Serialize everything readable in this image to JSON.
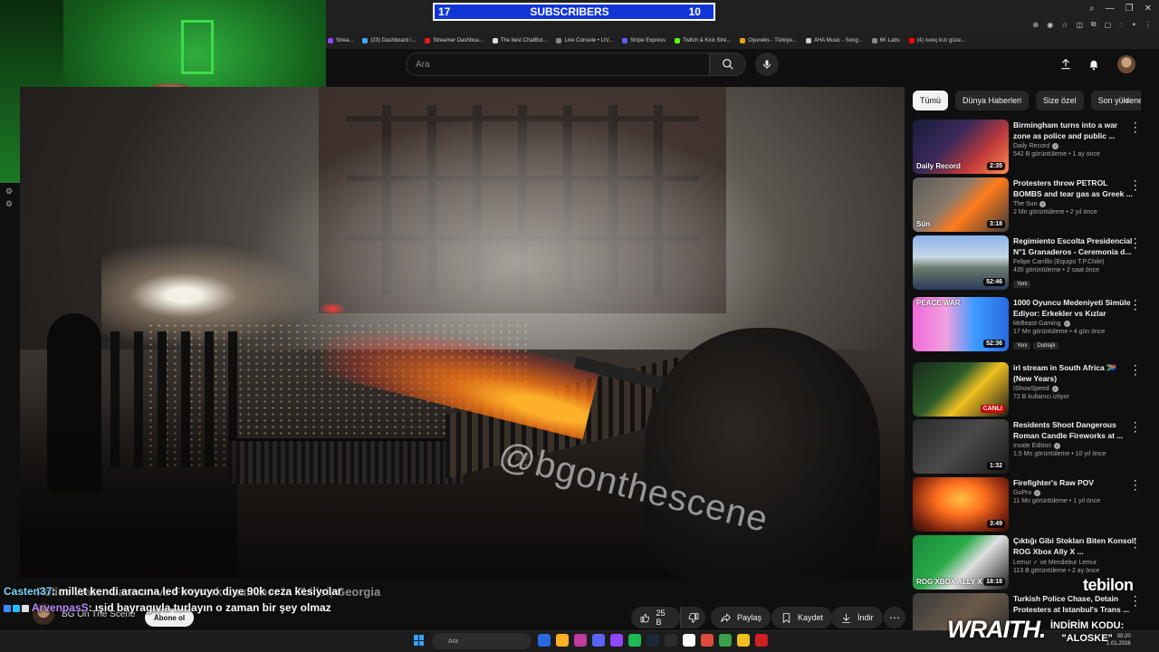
{
  "overlay": {
    "subscriber_bar": {
      "current": "17",
      "label": "SUBSCRIBERS",
      "goal": "10"
    },
    "tebilon": "tebilon",
    "wraith": "WRAITH.",
    "promo_label": "İNDİRİM KODU:",
    "promo_code": "\"ALOSKE\""
  },
  "bookmarks": [
    {
      "label": "Strea...",
      "color": "#9146ff"
    },
    {
      "label": "(23) Dashboard /...",
      "color": "#3ea6ff"
    },
    {
      "label": "Streamer Dashboa...",
      "color": "#e91916"
    },
    {
      "label": "The best ChatBot...",
      "color": "#dddddd"
    },
    {
      "label": "Live Console • LIV...",
      "color": "#888888"
    },
    {
      "label": "Stripe Express",
      "color": "#635bff"
    },
    {
      "label": "Twitch & Kick Stre...",
      "color": "#53fc18"
    },
    {
      "label": "Oyuneks - Türkiye...",
      "color": "#e8a317"
    },
    {
      "label": "AHA Music - Song...",
      "color": "#cccccc"
    },
    {
      "label": "6K Labs",
      "color": "#888888"
    },
    {
      "label": "(4) isveç kızı güze...",
      "color": "#ff0000"
    }
  ],
  "search": {
    "placeholder": "Ara"
  },
  "video": {
    "watermark": "@bgonthescene",
    "title": "Police Water Cannon vs Firework Launcher in Tbilisi, Georgia",
    "channel": "BG On The Scene",
    "subscribe_label": "Abone ol",
    "likes": "25 B",
    "share_label": "Paylaş",
    "save_label": "Kaydet",
    "download_label": "İndir"
  },
  "chat": [
    {
      "user": "Casten37",
      "message": ": millet kendi aracına led koyuyo diye 90k ceza kesiyolar"
    },
    {
      "user": "ArvenpasS",
      "message": ": ışid bayragıyla turlayın o zaman bir şey olmaz"
    }
  ],
  "chips": [
    "Tümü",
    "Dünya Haberleri",
    "Size özel",
    "Son yüklenenler"
  ],
  "recommendations": [
    {
      "title": "Birmingham turns into a war zone as police and public ...",
      "channel": "Daily Record",
      "verified": true,
      "meta": "542 B görüntüleme • 1 ay önce",
      "duration": "2:35",
      "thumb_text": "Daily Record",
      "thumb": "linear-gradient(135deg,#1a1a3a 0%,#3a2a5a 40%,#c03a3a 70%,#ff8a4a 100%)"
    },
    {
      "title": "Protesters throw PETROL BOMBS and tear gas as Greek ...",
      "channel": "The Sun",
      "verified": true,
      "meta": "2 Mn görüntüleme • 2 yıl önce",
      "duration": "3:18",
      "thumb_text": "Sün",
      "thumb": "linear-gradient(135deg,#5a5a5a 0%,#8a7a6a 40%,#ff7a1a 60%,#3a3a3a 100%)"
    },
    {
      "title": "Regimiento Escolta Presidencial N°1 Granaderos - Ceremonia d...",
      "channel": "Felipe Carrillo (Equipo T.P.Chile)",
      "verified": false,
      "meta": "435 görüntüleme • 2 saat önce",
      "duration": "52:46",
      "badges": [
        "Yeni"
      ],
      "thumb_text": "",
      "thumb": "linear-gradient(180deg,#8ab4e8 0%,#c8d8e8 40%,#6a7a6a 60%,#2a3a5a 100%)"
    },
    {
      "title": "1000 Oyuncu Medeniyeti Simüle Ediyor: Erkekler vs Kızlar",
      "channel": "MrBeast Gaming",
      "verified": true,
      "meta": "17 Mn görüntüleme • 4 gün önce",
      "duration": "52:36",
      "badges": [
        "Yeni",
        "Dublajlı"
      ],
      "thumb_text": "PEACE   WAR",
      "thumb": "linear-gradient(90deg,#f06ad8 0%,#f0a0e0 35%,#3a9aff 65%,#2a6adf 100%)"
    },
    {
      "title": "irl stream in South Africa 🇿🇦 (New Years)",
      "channel": "IShowSpeed",
      "verified": true,
      "meta": "72 B kullanıcı izliyor",
      "duration": "CANLI",
      "live": true,
      "thumb_text": "",
      "thumb": "linear-gradient(135deg,#1a2a1a 0%,#2a5a2a 40%,#f0c020 60%,#1a1a1a 100%)"
    },
    {
      "title": "Residents Shoot Dangerous Roman Candle Fireworks at ...",
      "channel": "Inside Edition",
      "verified": true,
      "meta": "1,5 Mn görüntüleme • 10 yıl önce",
      "duration": "1:32",
      "thumb_text": "",
      "thumb": "linear-gradient(135deg,#2a2a2a 0%,#4a4a4a 50%,#1a1a1a 100%)"
    },
    {
      "title": "Firefighter's Raw POV",
      "channel": "GoPro",
      "verified": true,
      "meta": "11 Mn görüntüleme • 1 yıl önce",
      "duration": "3:49",
      "thumb_text": "",
      "thumb": "radial-gradient(ellipse at 50% 40%,#ffc040 0%,#ff7020 35%,#8a2a10 70%,#2a0a05 100%)"
    },
    {
      "title": "Çıktığı Gibi Stokları Biten Konsol! ROG Xbox Ally X ...",
      "channel": "Lemur ✓ ve Mendebur Lemur",
      "verified": false,
      "meta": "113 B görüntüleme • 2 ay önce",
      "duration": "18:18",
      "thumb_text": "ROG XBOX ALLY X",
      "thumb": "linear-gradient(135deg,#1a8a3a 0%,#2aaa4a 40%,#e0e0e0 60%,#1a1a1a 100%)"
    },
    {
      "title": "Turkish Police Chase, Detain Protesters at Istanbul's Trans ...",
      "channel": "",
      "verified": false,
      "meta": "",
      "duration": "",
      "thumb_text": "",
      "thumb": "linear-gradient(135deg,#3a3a3a 0%,#6a5a4a 50%,#2a2a2a 100%)"
    }
  ],
  "taskbar": {
    "search_placeholder": "Ara",
    "time": "00:20",
    "date": "1.01.2026",
    "apps": [
      "#2a6adf",
      "#ffb020",
      "#c03aa0",
      "#5865f2",
      "#9146ff",
      "#1db954",
      "#1b2838",
      "#2c2c2c",
      "#ffffff",
      "#e04a3a",
      "#3aa04a",
      "#f0c020",
      "#d02020"
    ]
  }
}
